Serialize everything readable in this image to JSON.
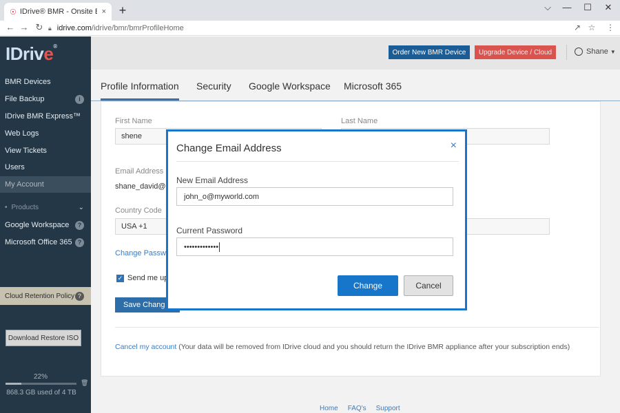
{
  "browser": {
    "tab_title": "IDrive® BMR - Onsite Bare M",
    "tab_close": "×",
    "new_tab": "+",
    "url_host": "idrive.com",
    "url_path": "/idrive/bmr/bmrProfileHome",
    "win_minimize": "—",
    "win_restore": "☐",
    "win_close": "✕"
  },
  "sidebar": {
    "logo_text": "IDriv",
    "logo_e": "e",
    "logo_reg": "®",
    "items": [
      {
        "label": "BMR Devices"
      },
      {
        "label": "File Backup"
      },
      {
        "label": "IDrive BMR Express™"
      },
      {
        "label": "Web Logs"
      },
      {
        "label": "View Tickets"
      },
      {
        "label": "Users"
      },
      {
        "label": "My Account"
      }
    ],
    "products_label": "Products",
    "product_items": [
      {
        "label": "Google Workspace"
      },
      {
        "label": "Microsoft Office 365"
      }
    ],
    "retention_label": "Cloud Retention Policy",
    "download_iso_label": "Download Restore ISO",
    "usage_percent_label": "22%",
    "usage_fraction": 0.22,
    "usage_text": "868.3 GB used of 4 TB"
  },
  "topbar": {
    "order_label": "Order New BMR Device",
    "upgrade_label": "Upgrade Device / Cloud",
    "user_name": "Shane"
  },
  "profile_tabs": [
    {
      "label": "Profile Information"
    },
    {
      "label": "Security"
    },
    {
      "label": "Google Workspace"
    },
    {
      "label": "Microsoft 365"
    }
  ],
  "form": {
    "first_name_label": "First Name",
    "first_name_value": "shene",
    "last_name_label": "Last Name",
    "email_label": "Email Address (",
    "email_value": "shane_david@m",
    "country_label": "Country Code",
    "country_value": "USA +1",
    "change_password_link": "Change Passwo",
    "send_me_label": "Send me up",
    "save_button": "Save Chang",
    "cancel_account_link": "Cancel my account",
    "cancel_account_text": " (Your data will be removed from IDrive cloud and you should return the IDrive BMR appliance after your subscription ends)"
  },
  "footer": {
    "home": "Home",
    "faqs": "FAQ's",
    "support": "Support"
  },
  "modal": {
    "title": "Change Email Address",
    "close": "×",
    "new_email_label": "New Email Address",
    "new_email_value": "john_o@myworld.com",
    "password_label": "Current Password",
    "password_value": "•••••••••••••",
    "change_button": "Change",
    "cancel_button": "Cancel"
  },
  "colors": {
    "sidebar_bg": "#243746",
    "accent_blue": "#1776c9",
    "upgrade_red": "#d9534f"
  }
}
